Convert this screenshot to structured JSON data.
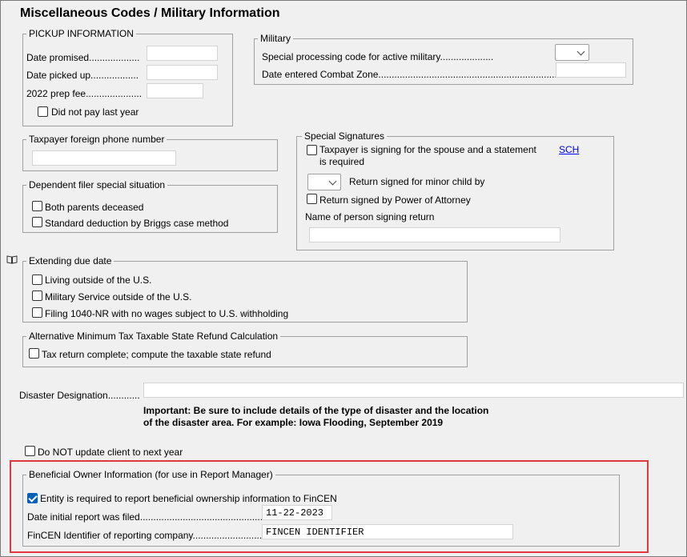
{
  "page": {
    "title": "Miscellaneous Codes / Military Information"
  },
  "pickup": {
    "legend": "PICKUP INFORMATION",
    "date_promised": "Date promised...................",
    "date_picked_up": "Date picked up..................",
    "prep_fee": "2022 prep fee.....................",
    "did_not_pay": "Did not pay last year"
  },
  "military": {
    "legend": "Military",
    "special_code": "Special processing code for active military....................",
    "combat_zone": "Date entered Combat Zone................................................................................"
  },
  "foreign_phone": {
    "legend": "Taxpayer foreign phone number"
  },
  "special_signatures": {
    "legend": "Special Signatures",
    "spouse_line1": "Taxpayer is signing for the spouse and a statement",
    "spouse_line2": "is required",
    "sch_link": "SCH",
    "minor_child": "Return signed for minor child by",
    "poa": "Return signed by Power of Attorney",
    "name_label": "Name of person signing return"
  },
  "dependent": {
    "legend": "Dependent filer special situation",
    "both_parents": "Both parents deceased",
    "briggs": "Standard deduction by Briggs case method"
  },
  "extending": {
    "legend": "Extending due date",
    "living_outside": "Living outside of the U.S.",
    "military_service": "Military Service outside of the U.S.",
    "filing_1040nr": "Filing 1040-NR with no wages subject to U.S. withholding"
  },
  "amt": {
    "legend": "Alternative Minimum Tax Taxable State Refund Calculation",
    "complete": "Tax return complete; compute the taxable state refund"
  },
  "disaster": {
    "label": "Disaster Designation............",
    "note_line1": "Important:  Be sure to include details of the type of disaster and the location",
    "note_line2": "of the disaster area.  For example: Iowa Flooding, September 2019"
  },
  "no_update": "Do NOT update client to next year",
  "beneficial": {
    "legend": "Beneficial Owner Information (for use in Report Manager)",
    "entity_required": "Entity is required to report beneficial ownership information to FinCEN",
    "date_label": "Date initial report was filed...........................................................",
    "date_value": "11-22-2023",
    "fincen_label": "FinCEN Identifier of reporting company...........................",
    "fincen_value": "FINCEN IDENTIFIER"
  }
}
